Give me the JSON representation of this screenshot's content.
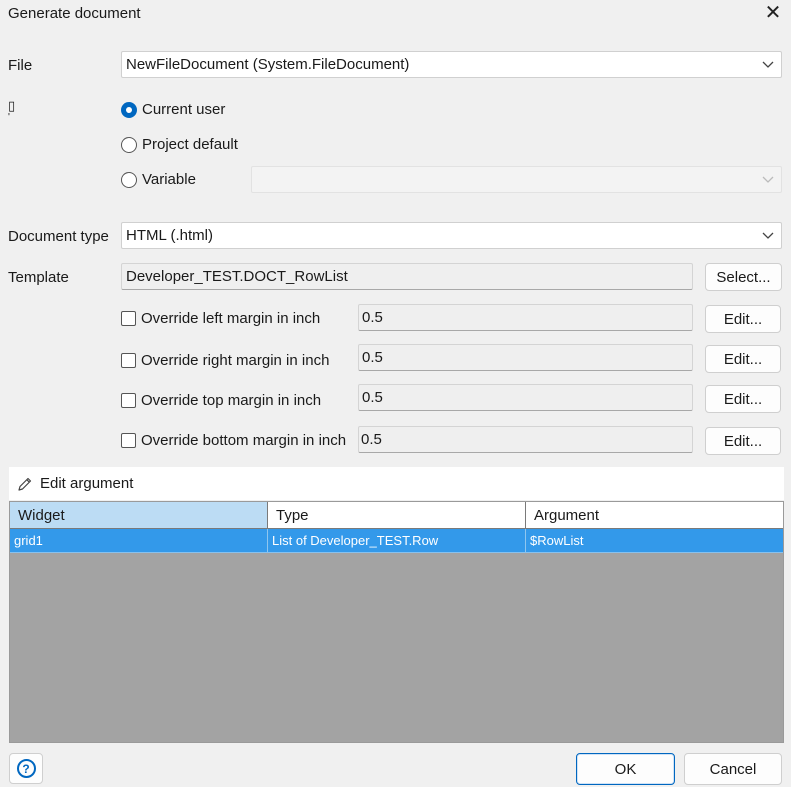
{
  "dialog": {
    "title": "Generate document",
    "close_glyph": "✕"
  },
  "file": {
    "label": "File",
    "value": "NewFileDocument (System.FileDocument)"
  },
  "language": {
    "label_glyph": "▯",
    "options": [
      {
        "label": "Current user",
        "checked": true
      },
      {
        "label": "Project default",
        "checked": false
      },
      {
        "label": "Variable",
        "checked": false
      }
    ],
    "variable_value": ""
  },
  "document_type": {
    "label": "Document type",
    "value": "HTML (.html)"
  },
  "template": {
    "label": "Template",
    "value": "Developer_TEST.DOCT_RowList",
    "select_label": "Select..."
  },
  "margins": [
    {
      "label": "Override left margin in inch",
      "value": "0.5",
      "edit_label": "Edit..."
    },
    {
      "label": "Override right margin in inch",
      "value": "0.5",
      "edit_label": "Edit..."
    },
    {
      "label": "Override top margin in inch",
      "value": "0.5",
      "edit_label": "Edit..."
    },
    {
      "label": "Override bottom margin in inch",
      "value": "0.5",
      "edit_label": "Edit..."
    }
  ],
  "toolbar": {
    "edit_argument_label": "Edit argument",
    "edit_icon": "pencil-icon"
  },
  "grid": {
    "columns": [
      "Widget",
      "Type",
      "Argument"
    ],
    "rows": [
      [
        "grid1",
        "List of Developer_TEST.Row",
        "$RowList"
      ]
    ]
  },
  "footer": {
    "help_glyph": "?",
    "ok_label": "OK",
    "cancel_label": "Cancel"
  },
  "colors": {
    "accent": "#0067c0",
    "selected_row": "#3399ea",
    "grid_background": "#a3a3a3"
  }
}
